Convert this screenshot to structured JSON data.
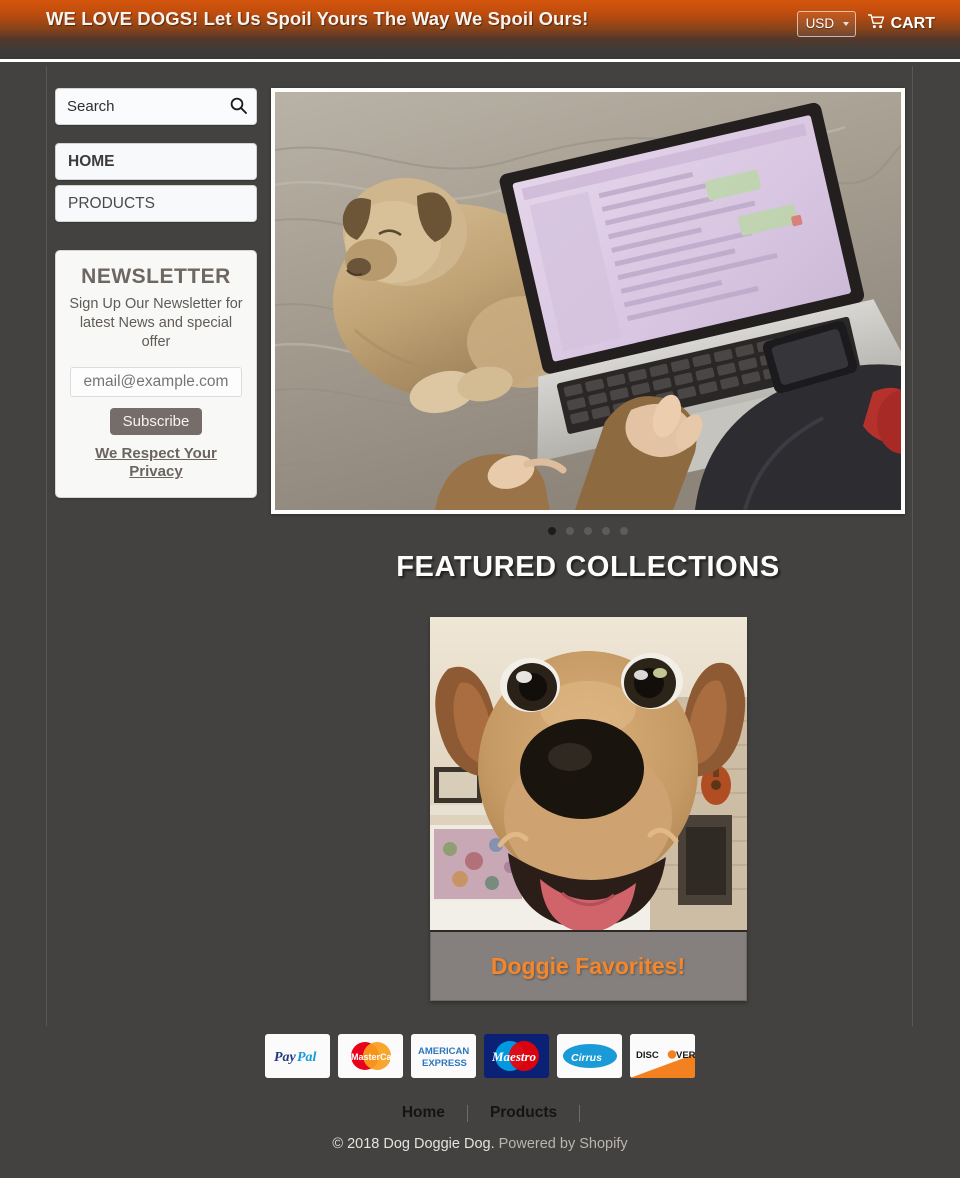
{
  "header": {
    "brand_title": "WE LOVE DOGS! Let Us Spoil Yours The Way We Spoil Ours!",
    "currency_selected": "USD",
    "currency_options": [
      "USD"
    ],
    "cart_label": "CART",
    "accent_color": "#d4550c"
  },
  "sidebar": {
    "search": {
      "placeholder": "Search",
      "value": ""
    },
    "nav": [
      {
        "label": "HOME",
        "active": true
      },
      {
        "label": "PRODUCTS",
        "active": false
      }
    ],
    "newsletter": {
      "heading": "NEWSLETTER",
      "description": "Sign Up Our Newsletter for latest News and special offer",
      "email_value": "email@example.com",
      "email_placeholder": "email@example.com",
      "button_label": "Subscribe",
      "privacy_label": "We Respect Your Privacy"
    }
  },
  "main": {
    "carousel": {
      "slide_count": 5,
      "active_slide": 1,
      "alt": "Dog sleeping on bed next to person using a laptop"
    },
    "featured_title": "FEATURED COLLECTIONS",
    "collections": [
      {
        "title": "Doggie Favorites!",
        "title_color": "#f4862b",
        "alt": "Close-up of a happy dog with mouth open"
      }
    ]
  },
  "footer": {
    "payment_methods": [
      "PayPal",
      "MasterCard",
      "American Express",
      "Maestro",
      "Cirrus",
      "Discover"
    ],
    "links": [
      "Home",
      "Products"
    ],
    "copyright": "© 2018 Dog Doggie Dog.",
    "powered_by": "Powered by Shopify"
  }
}
